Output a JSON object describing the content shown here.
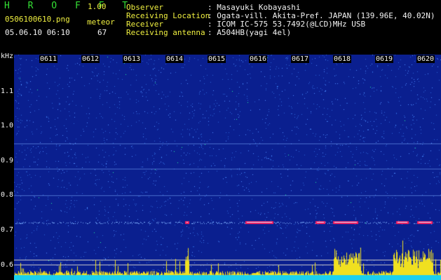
{
  "header": {
    "app_title": "H R O F F T",
    "version": "1.00",
    "filename": "0506100610.png",
    "datetime": "05.06.10 06:10",
    "counter_label": "meteor",
    "counter_value": "67",
    "fields": [
      {
        "label": "Observer",
        "value": ": Masayuki Kobayashi"
      },
      {
        "label": "Receiving Location",
        "value": ": Ogata-vill. Akita-Pref. JAPAN (139.96E, 40.02N)"
      },
      {
        "label": "Receiver",
        "value": ": ICOM IC-575 53.7492(@LCD)MHz USB"
      },
      {
        "label": "Receiving antenna",
        "value": ": A504HB(yagi 4el)"
      }
    ]
  },
  "spectrogram": {
    "freq_unit": "kHz",
    "freq_ticks": [
      "1.1",
      "1.0",
      "0.9",
      "0.8",
      "0.7",
      "0.6"
    ],
    "time_ticks": [
      "0611",
      "0612",
      "0613",
      "0614",
      "0615",
      "0616",
      "0617",
      "0618",
      "0619",
      "0620"
    ],
    "colors": {
      "background": "#0a1f8f",
      "noise": "#2a63d8",
      "signal": "#f0e020",
      "echo": "#ff2060",
      "cyan": "#1ad0f0"
    }
  }
}
